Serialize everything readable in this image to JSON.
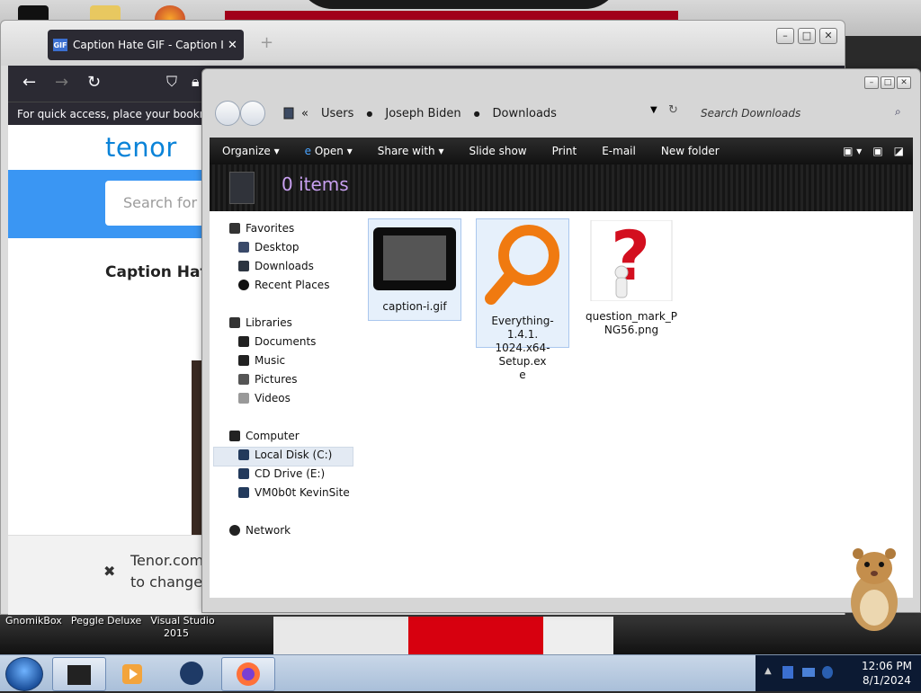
{
  "browser": {
    "tab_title": "Caption Hate GIF - Caption I Hate",
    "tab_favicon": "GIF",
    "bookmark_hint": "For quick access, place your bookmarks",
    "page": {
      "logo": "tenor",
      "search_placeholder": "Search for GIFs",
      "heading": "Caption Hate",
      "cookie_line1": "Tenor.com",
      "cookie_line2": "to change"
    }
  },
  "explorer": {
    "breadcrumb": [
      "Users",
      "Joseph Biden",
      "Downloads"
    ],
    "breadcrumb_overflow": "«",
    "search_placeholder": "Search Downloads",
    "toolbar": {
      "organize": "Organize",
      "open": "Open",
      "share_with": "Share with",
      "slide_show": "Slide show",
      "print": "Print",
      "email": "E-mail",
      "new_folder": "New folder"
    },
    "item_count": "0 items",
    "nav": {
      "favorites": "Favorites",
      "desktop": "Desktop",
      "downloads": "Downloads",
      "recent_places": "Recent Places",
      "libraries": "Libraries",
      "documents": "Documents",
      "music": "Music",
      "pictures": "Pictures",
      "videos": "Videos",
      "computer": "Computer",
      "local_disk": "Local Disk (C:)",
      "cd_drive": "CD Drive (E:)",
      "vm_share": "VM0b0t KevinSite",
      "network": "Network"
    },
    "files": [
      {
        "name_line1": "caption-i.gif",
        "name_line2": "",
        "name_line3": ""
      },
      {
        "name_line1": "Everything-1.4.1.",
        "name_line2": "1024.x64-Setup.ex",
        "name_line3": "e"
      },
      {
        "name_line1": "question_mark_P",
        "name_line2": "NG56.png",
        "name_line3": ""
      }
    ]
  },
  "desktop": {
    "icon_labels": [
      "GnomikBox",
      "Peggle Deluxe",
      "Visual Studio"
    ],
    "icon_sublabel": "2015"
  },
  "taskbar": {
    "time": "12:06 PM",
    "date": "8/1/2024"
  },
  "colors": {
    "tenor_blue": "#3a96f3",
    "item_count_purple": "#c8a0f0",
    "taskbar": "#b9cbe2"
  }
}
